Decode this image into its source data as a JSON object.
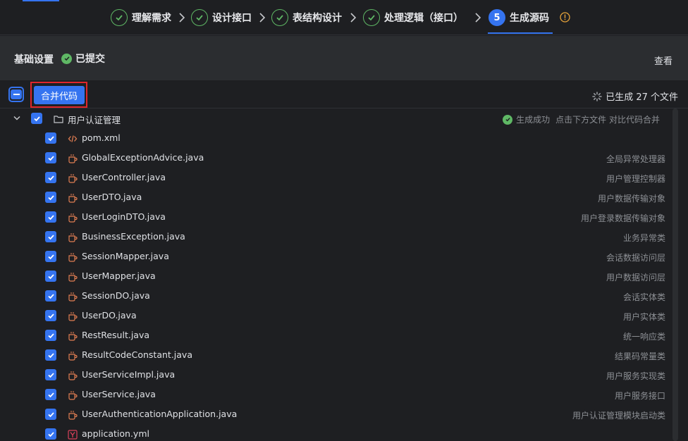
{
  "stepper": {
    "steps": [
      {
        "label": "理解需求",
        "status": "done"
      },
      {
        "label": "设计接口",
        "status": "done"
      },
      {
        "label": "表结构设计",
        "status": "done"
      },
      {
        "label": "处理逻辑（接口）",
        "status": "done"
      },
      {
        "label": "生成源码",
        "status": "active",
        "number": "5"
      }
    ]
  },
  "settings": {
    "title": "基础设置",
    "status": "已提交",
    "view_link": "查看"
  },
  "toolbar": {
    "merge_button": "合并代码",
    "generated_count": "已生成 27 个文件"
  },
  "tree": {
    "folder": {
      "name": "用户认证管理",
      "status": "生成成功",
      "hint": "点击下方文件 对比代码合并"
    },
    "files": [
      {
        "name": "pom.xml",
        "desc": "",
        "icon": "xml-icon"
      },
      {
        "name": "GlobalExceptionAdvice.java",
        "desc": "全局异常处理器",
        "icon": "java-icon"
      },
      {
        "name": "UserController.java",
        "desc": "用户管理控制器",
        "icon": "java-icon"
      },
      {
        "name": "UserDTO.java",
        "desc": "用户数据传输对象",
        "icon": "java-icon"
      },
      {
        "name": "UserLoginDTO.java",
        "desc": "用户登录数据传输对象",
        "icon": "java-icon"
      },
      {
        "name": "BusinessException.java",
        "desc": "业务异常类",
        "icon": "java-icon"
      },
      {
        "name": "SessionMapper.java",
        "desc": "会话数据访问层",
        "icon": "java-icon"
      },
      {
        "name": "UserMapper.java",
        "desc": "用户数据访问层",
        "icon": "java-icon"
      },
      {
        "name": "SessionDO.java",
        "desc": "会话实体类",
        "icon": "java-icon"
      },
      {
        "name": "UserDO.java",
        "desc": "用户实体类",
        "icon": "java-icon"
      },
      {
        "name": "RestResult.java",
        "desc": "统一响应类",
        "icon": "java-icon"
      },
      {
        "name": "ResultCodeConstant.java",
        "desc": "结果码常量类",
        "icon": "java-icon"
      },
      {
        "name": "UserServiceImpl.java",
        "desc": "用户服务实现类",
        "icon": "java-icon"
      },
      {
        "name": "UserService.java",
        "desc": "用户服务接口",
        "icon": "java-icon"
      },
      {
        "name": "UserAuthenticationApplication.java",
        "desc": "用户认证管理模块启动类",
        "icon": "java-icon"
      },
      {
        "name": "application.yml",
        "desc": "",
        "icon": "yaml-icon"
      }
    ]
  },
  "colors": {
    "accent": "#3574f0",
    "success": "#5fb865",
    "highlight": "#e0262b",
    "java_icon": "#e07d52",
    "yaml_icon": "#d9415a"
  }
}
